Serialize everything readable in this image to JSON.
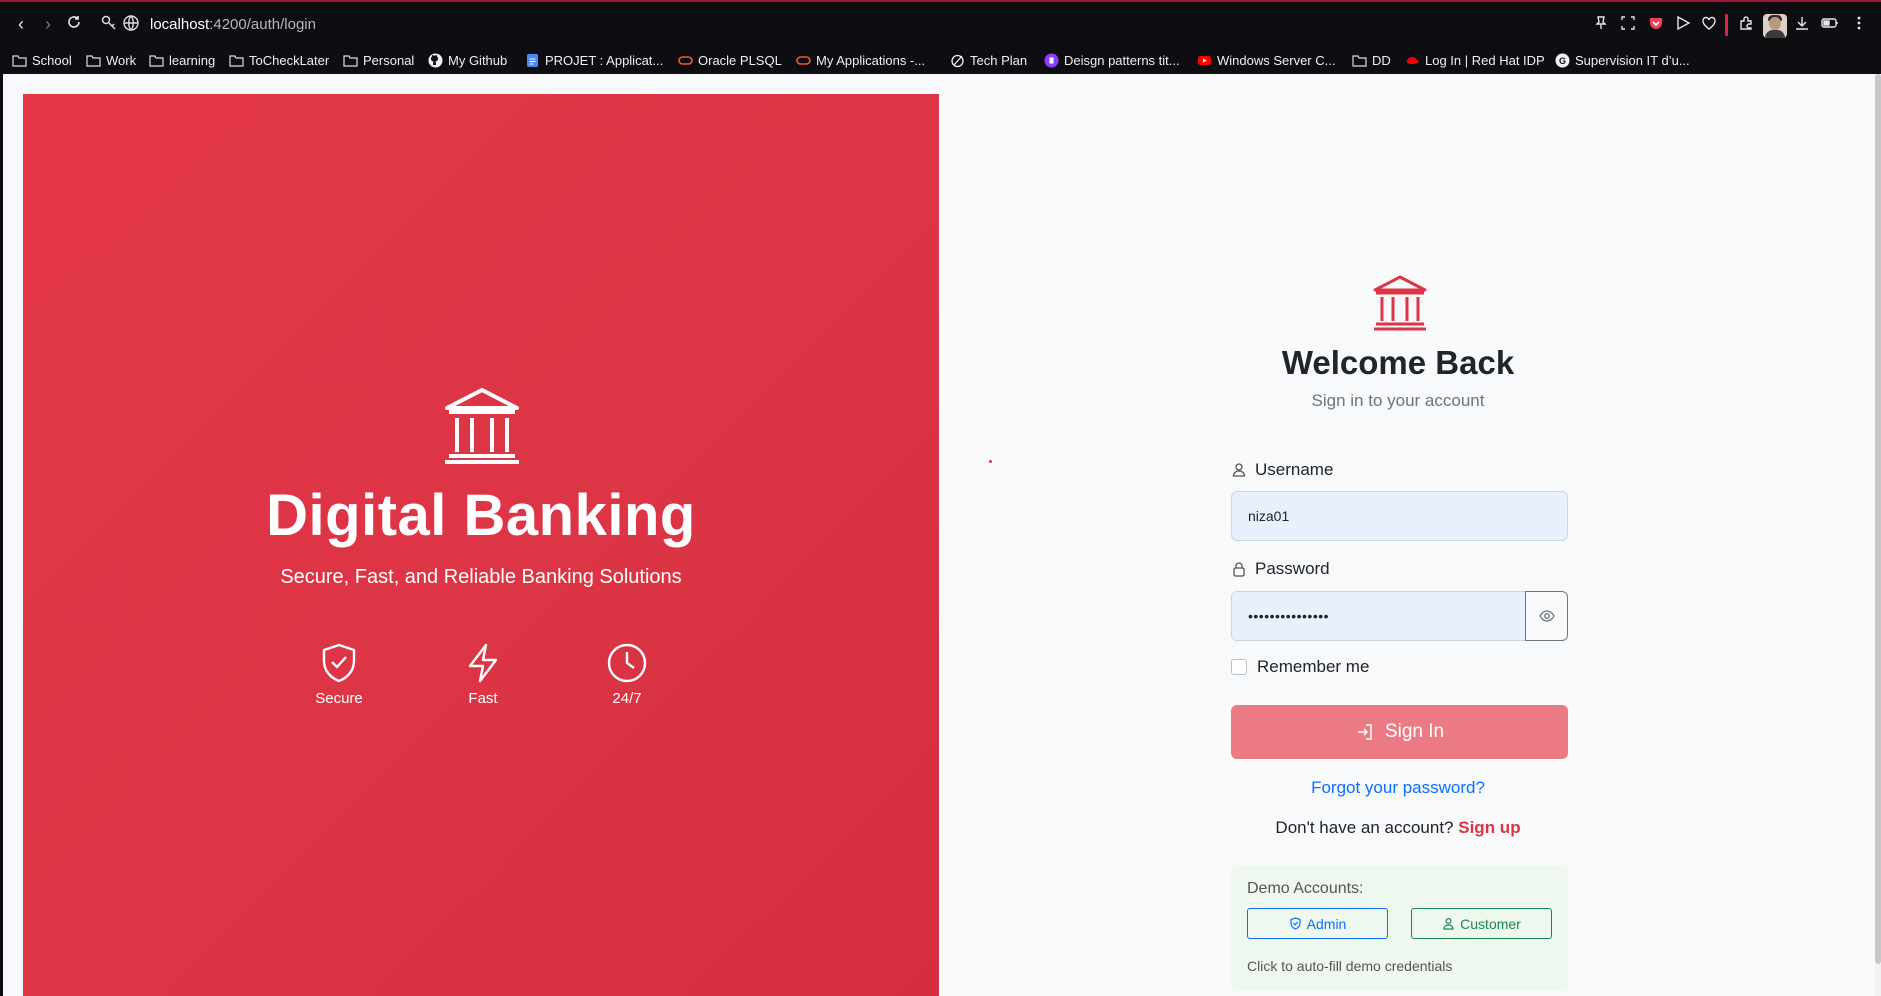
{
  "browser": {
    "url_host": "localhost",
    "url_path": ":4200/auth/login",
    "bookmarks": [
      {
        "label": "School",
        "icon": "folder-icon"
      },
      {
        "label": "Work",
        "icon": "folder-icon"
      },
      {
        "label": "learning",
        "icon": "folder-icon"
      },
      {
        "label": "ToCheckLater",
        "icon": "folder-icon"
      },
      {
        "label": "Personal",
        "icon": "folder-icon"
      },
      {
        "label": "My Github",
        "icon": "github-icon"
      },
      {
        "label": "PROJET : Applicat...",
        "icon": "google-docs-icon"
      },
      {
        "label": "Oracle PLSQL",
        "icon": "oracle-icon"
      },
      {
        "label": "My Applications -...",
        "icon": "oracle-icon"
      },
      {
        "label": "Tech Plan",
        "icon": "planner-icon"
      },
      {
        "label": "Deisgn patterns tit...",
        "icon": "purple-site-icon"
      },
      {
        "label": "Windows Server C...",
        "icon": "youtube-icon"
      },
      {
        "label": "DD",
        "icon": "folder-icon"
      },
      {
        "label": "Log In | Red Hat IDP",
        "icon": "redhat-icon"
      },
      {
        "label": "Supervision IT d’u...",
        "icon": "google-icon"
      }
    ]
  },
  "hero": {
    "title": "Digital Banking",
    "subtitle": "Secure, Fast, and Reliable Banking Solutions",
    "features": [
      {
        "label": "Secure",
        "icon": "shield-check-icon"
      },
      {
        "label": "Fast",
        "icon": "lightning-icon"
      },
      {
        "label": "24/7",
        "icon": "clock-icon"
      }
    ]
  },
  "login": {
    "title": "Welcome Back",
    "subtitle": "Sign in to your account",
    "username_label": "Username",
    "username_value": "niza01",
    "password_label": "Password",
    "password_masked": "•••••••••••••••",
    "remember_label": "Remember me",
    "signin_label": "Sign In",
    "forgot_label": "Forgot your password?",
    "no_account_text": "Don't have an account?",
    "signup_label": "Sign up",
    "demo": {
      "title": "Demo Accounts:",
      "admin_label": "Admin",
      "customer_label": "Customer",
      "hint": "Click to auto-fill demo credentials"
    }
  },
  "colors": {
    "brand_red": "#dc3545",
    "signin_button_disabled": "#ec7a84",
    "link_blue": "#0d6efd",
    "success_green": "#198754"
  }
}
